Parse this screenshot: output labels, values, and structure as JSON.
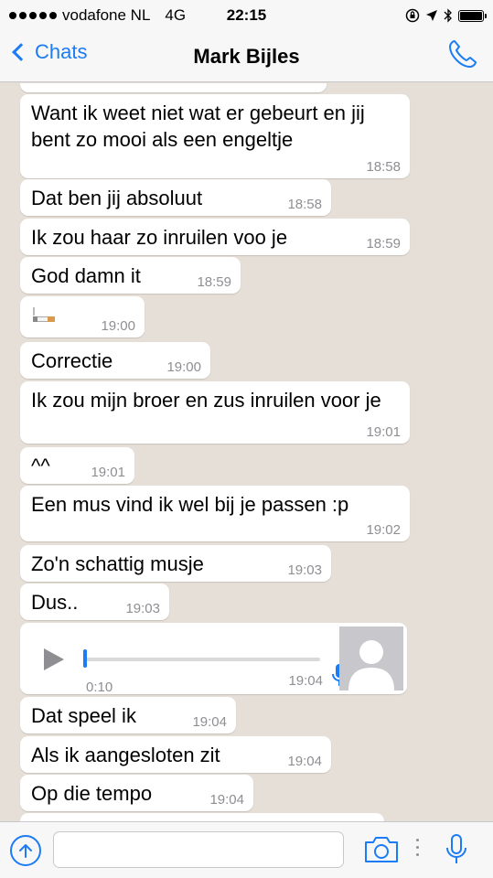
{
  "status_bar": {
    "carrier": "vodafone NL",
    "network": "4G",
    "time": "22:15"
  },
  "nav": {
    "back_label": "Chats",
    "title": "Mark Bijles"
  },
  "messages": [
    {
      "text": "Want ik weet niet wat er gebeurt en jij bent zo mooi als een engeltje",
      "time": "18:58"
    },
    {
      "text": "Dat ben jij absoluut",
      "time": "18:58"
    },
    {
      "text": "Ik zou haar zo inruilen voo je",
      "time": "18:59"
    },
    {
      "text": "God damn it",
      "time": "18:59"
    },
    {
      "text": "",
      "emoji": "cigarette-emoji",
      "time": "19:00"
    },
    {
      "text": "Correctie",
      "time": "19:00"
    },
    {
      "text": "Ik zou mijn broer en zus inruilen voor je",
      "time": "19:01"
    },
    {
      "text": "^^",
      "time": "19:01"
    },
    {
      "text": "Een mus vind ik wel bij je passen :p",
      "time": "19:02"
    },
    {
      "text": "Zo'n schattig musje",
      "time": "19:03"
    },
    {
      "text": "Dus..",
      "time": "19:03"
    },
    {
      "type": "voice",
      "duration": "0:10",
      "time": "19:04"
    },
    {
      "text": "Dat speel ik",
      "time": "19:04"
    },
    {
      "text": "Als ik aangesloten zit",
      "time": "19:04"
    },
    {
      "text": "Op die tempo",
      "time": "19:04"
    }
  ],
  "input": {
    "placeholder": ""
  },
  "colors": {
    "accent": "#1b7cf5",
    "bubble": "#ffffff",
    "background": "#e6dfd7",
    "timestamp": "#8e8e93"
  }
}
